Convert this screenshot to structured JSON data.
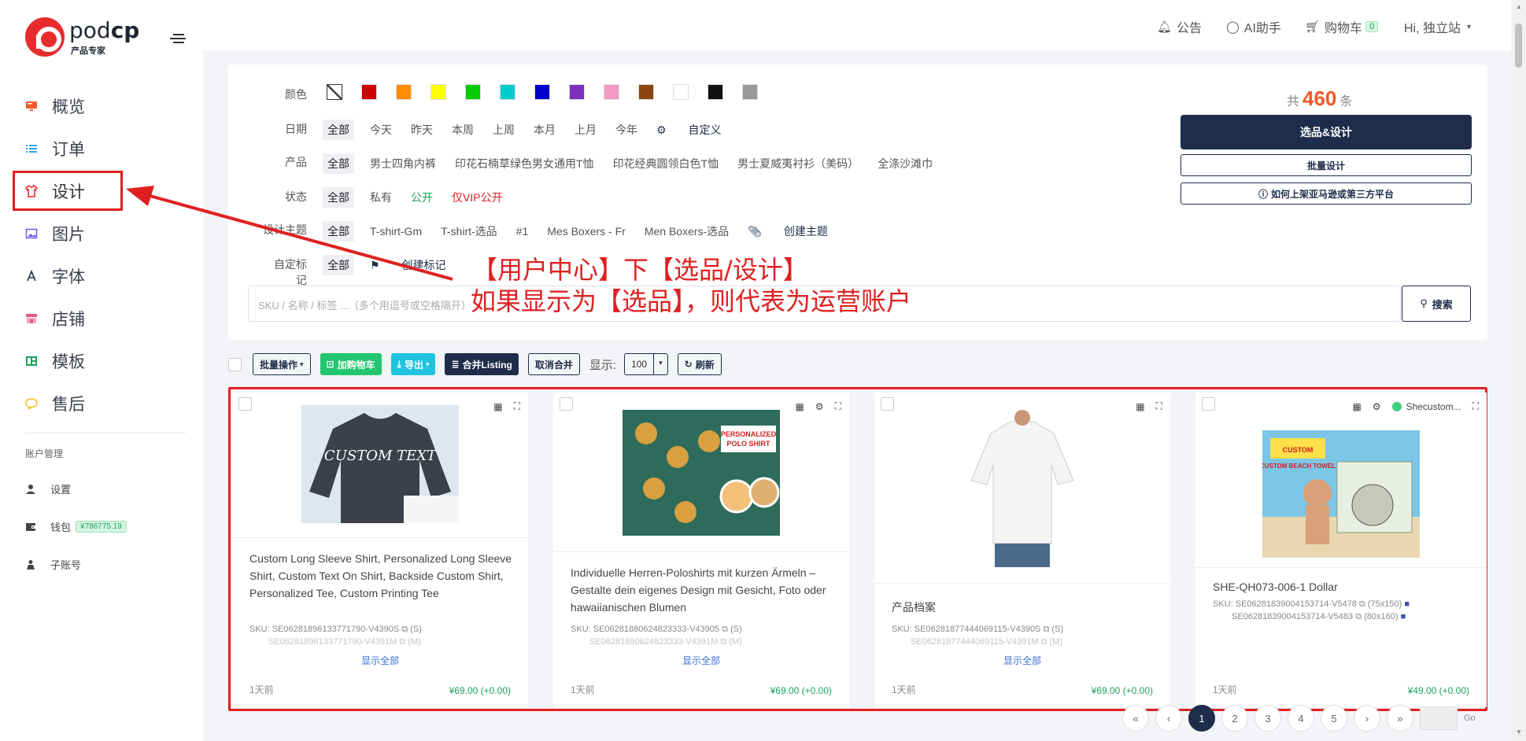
{
  "brand": {
    "name_prefix": "pod",
    "name_bold": "cp",
    "subtitle": "产品专家"
  },
  "sidebar": {
    "items": [
      {
        "label": "概览",
        "icon": "monitor-icon",
        "color": "#f05a28"
      },
      {
        "label": "订单",
        "icon": "list-icon",
        "color": "#2aa7e0"
      },
      {
        "label": "设计",
        "icon": "tshirt-icon",
        "color": "#e02020"
      },
      {
        "label": "图片",
        "icon": "image-icon",
        "color": "#6c5ce7"
      },
      {
        "label": "字体",
        "icon": "font-icon",
        "color": "#1e2d4a"
      },
      {
        "label": "店铺",
        "icon": "store-icon",
        "color": "#e05a8a"
      },
      {
        "label": "模板",
        "icon": "template-icon",
        "color": "#1aa35a"
      },
      {
        "label": "售后",
        "icon": "chat-icon",
        "color": "#f0c020"
      }
    ],
    "account_title": "账户管理",
    "account_items": [
      {
        "label": "设置",
        "icon": "user-icon"
      },
      {
        "label": "钱包",
        "icon": "wallet-icon",
        "badge": "¥786775.19"
      },
      {
        "label": "子账号",
        "icon": "sub-account-icon"
      }
    ]
  },
  "topbar": {
    "notice": "公告",
    "ai": "AI助手",
    "cart": "购物车",
    "cart_count": "0",
    "user": "Hi, 独立站"
  },
  "filters": {
    "color_label": "颜色",
    "colors": [
      "#ffffff",
      "#cc0000",
      "#ff8c00",
      "#ffff00",
      "#00cc00",
      "#00cccc",
      "#0000cc",
      "#7b2fbe",
      "#f49ac2",
      "#8b4513",
      "#ffffff",
      "#111111",
      "#999999"
    ],
    "date_label": "日期",
    "dates": [
      "全部",
      "今天",
      "昨天",
      "本周",
      "上周",
      "本月",
      "上月",
      "今年"
    ],
    "date_custom": "自定义",
    "product_label": "产品",
    "products": [
      "全部",
      "男士四角内裤",
      "印花石楠草绿色男女通用T恤",
      "印花经典圆领白色T恤",
      "男士夏威夷衬衫（美码）",
      "全涤沙滩巾"
    ],
    "status_label": "状态",
    "statuses": [
      "全部",
      "私有",
      "公开",
      "仅VIP公开"
    ],
    "theme_label": "设计主题",
    "themes": [
      "全部",
      "T-shirt-Gm",
      "T-shirt-选品",
      "#1",
      "Mes Boxers - Fr",
      "Men Boxers-选品"
    ],
    "theme_create": "创建主题",
    "mark_label": "自定标记",
    "marks": [
      "全部"
    ],
    "mark_create": "创建标记",
    "search_placeholder": "SKU / 名称 / 标签 ...（多个用逗号或空格隔开）",
    "search_btn": "搜索",
    "total_prefix": "共",
    "total_count": "460",
    "total_suffix": "条",
    "btn_select_design": "选品&设计",
    "btn_batch_design": "批量设计",
    "btn_how": "如何上架亚马逊或第三方平台"
  },
  "annotation": {
    "line1": "【用户中心】下【选品/设计】",
    "line2": "如果显示为【选品】，则代表为运营账户"
  },
  "toolbar": {
    "batch": "批量操作",
    "add_cart": "加购物车",
    "export": "导出",
    "merge": "合并Listing",
    "unmerge": "取消合并",
    "show_label": "显示:",
    "page_size": "100",
    "refresh": "刷新"
  },
  "cards": [
    {
      "title": "Custom Long Sleeve Shirt, Personalized Long Sleeve Shirt, Custom Text On Shirt, Backside Custom Shirt, Personalized Tee, Custom Printing Tee",
      "sku1": "SKU: SE06281896133771790-V4390S",
      "sku1_sfx": "(S)",
      "sku2": "SE06281896133771790-V4391M",
      "sku2_sfx": "(M)",
      "show_all": "显示全部",
      "time": "1天前",
      "price": "¥69.00 (+0.00)",
      "image_text": "CUSTOM TEXT"
    },
    {
      "title": "Individuelle Herren-Poloshirts mit kurzen Ärmeln – Gestalte dein eigenes Design mit Gesicht, Foto oder hawaiianischen Blumen",
      "sku1": "SKU: SE06281880624823333-V43905",
      "sku1_sfx": "(S)",
      "sku2": "SE06281880624823333-V4391M",
      "sku2_sfx": "(M)",
      "show_all": "显示全部",
      "time": "1天前",
      "price": "¥69.00 (+0.00)",
      "image_text": "PERSONALIZED POLO SHIRT"
    },
    {
      "title": "产品档案",
      "sku1": "SKU: SE06281877444069115-V4390S",
      "sku1_sfx": "(S)",
      "sku2": "SE06281877444069115-V4391M",
      "sku2_sfx": "(M)",
      "show_all": "显示全部",
      "time": "1天前",
      "price": "¥69.00 (+0.00)",
      "image_text": ""
    },
    {
      "title": "SHE-QH073-006-1 Dollar",
      "store": "Shecustom...",
      "sku1": "SKU: SE06281839004153714-V5478",
      "sku1_sfx": "(75x150)",
      "sku2": "SE06281839004153714-V5483",
      "sku2_sfx": "(80x160)",
      "show_all": "",
      "time": "1天前",
      "price": "¥49.00 (+0.00)",
      "image_text": "CUSTOM BEACH TOWEL"
    }
  ],
  "pager": {
    "current": "1",
    "pages": [
      "2",
      "3",
      "4",
      "5"
    ],
    "go": "Go"
  }
}
